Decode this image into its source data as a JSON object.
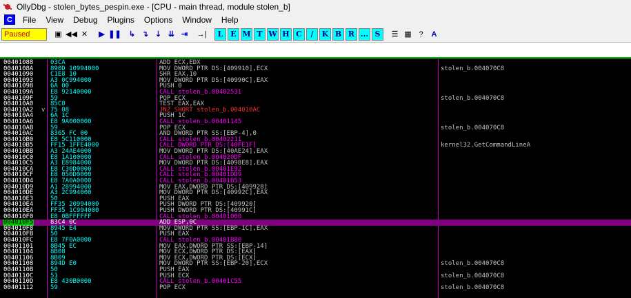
{
  "window": {
    "title": "OllyDbg - stolen_bytes_pespin.exe - [CPU - main thread, module stolen_b]"
  },
  "menu": {
    "c_label": "C",
    "items": [
      "File",
      "View",
      "Debug",
      "Plugins",
      "Options",
      "Window",
      "Help"
    ]
  },
  "toolbar": {
    "status": "Paused",
    "buttons": [
      {
        "name": "open-icon",
        "glyph": "▣"
      },
      {
        "name": "restart-icon",
        "glyph": "◀◀"
      },
      {
        "name": "close-icon",
        "glyph": "✕"
      },
      {
        "name": "run-icon",
        "glyph": "▶"
      },
      {
        "name": "pause-icon",
        "glyph": "❚❚"
      },
      {
        "name": "step-into-icon",
        "glyph": "↳"
      },
      {
        "name": "step-over-icon",
        "glyph": "↴"
      },
      {
        "name": "trace-into-icon",
        "glyph": "⇣"
      },
      {
        "name": "trace-over-icon",
        "glyph": "⇊"
      },
      {
        "name": "execute-till-return-icon",
        "glyph": "⇥"
      },
      {
        "name": "goto-icon",
        "glyph": "→|"
      }
    ],
    "letters": [
      "L",
      "E",
      "M",
      "T",
      "W",
      "H",
      "C",
      "/",
      "K",
      "B",
      "R",
      "...",
      "S"
    ],
    "extra_buttons": [
      {
        "name": "list-icon",
        "glyph": "☰"
      },
      {
        "name": "palette-icon",
        "glyph": "▦"
      },
      {
        "name": "help-icon",
        "glyph": "?"
      },
      {
        "name": "assembler-icon",
        "glyph": "A"
      }
    ]
  },
  "disasm": {
    "selected_index": 27,
    "rows": [
      {
        "addr": "00401088",
        "jmp": "",
        "hex": "03CA",
        "asm": "ADD ECX,EDX",
        "kind": "",
        "comment": ""
      },
      {
        "addr": "0040108A",
        "jmp": "",
        "hex": "890D 10994000",
        "asm": "MOV DWORD PTR DS:[409910],ECX",
        "kind": "",
        "comment": "stolen_b.004070C8"
      },
      {
        "addr": "00401090",
        "jmp": "",
        "hex": "C1E8 10",
        "asm": "SHR EAX,10",
        "kind": "",
        "comment": ""
      },
      {
        "addr": "00401093",
        "jmp": "",
        "hex": "A3 0C994000",
        "asm": "MOV DWORD PTR DS:[40990C],EAX",
        "kind": "",
        "comment": ""
      },
      {
        "addr": "00401098",
        "jmp": "",
        "hex": "6A 00",
        "asm": "PUSH 0",
        "kind": "",
        "comment": ""
      },
      {
        "addr": "0040109A",
        "jmp": "",
        "hex": "E8 92140000",
        "asm": "CALL stolen_b.00402531",
        "kind": "call",
        "comment": ""
      },
      {
        "addr": "0040109F",
        "jmp": "",
        "hex": "59",
        "asm": "POP ECX",
        "kind": "",
        "comment": "stolen_b.004070C8"
      },
      {
        "addr": "004010A0",
        "jmp": "",
        "hex": "85C0",
        "asm": "TEST EAX,EAX",
        "kind": "",
        "comment": ""
      },
      {
        "addr": "004010A2",
        "jmp": "v",
        "hex": "75 08",
        "asm": "JNZ SHORT stolen_b.004010AC",
        "kind": "jmp",
        "comment": ""
      },
      {
        "addr": "004010A4",
        "jmp": "",
        "hex": "6A 1C",
        "asm": "PUSH 1C",
        "kind": "",
        "comment": ""
      },
      {
        "addr": "004010A6",
        "jmp": "",
        "hex": "E8 9A000000",
        "asm": "CALL stolen_b.00401145",
        "kind": "call",
        "comment": ""
      },
      {
        "addr": "004010AB",
        "jmp": "",
        "hex": "59",
        "asm": "POP ECX",
        "kind": "",
        "comment": "stolen_b.004070C8"
      },
      {
        "addr": "004010AC",
        "jmp": "",
        "hex": "8365 FC 00",
        "asm": "AND DWORD PTR SS:[EBP-4],0",
        "kind": "",
        "comment": ""
      },
      {
        "addr": "004010B0",
        "jmp": "",
        "hex": "E8 5C110000",
        "asm": "CALL stolen_b.00402211",
        "kind": "call",
        "comment": ""
      },
      {
        "addr": "004010B5",
        "jmp": "",
        "hex": "FF15 1FFE4000",
        "asm": "CALL DWORD PTR DS:[40FE1F]",
        "kind": "call",
        "comment": "kernel32.GetCommandLineA"
      },
      {
        "addr": "004010BB",
        "jmp": "",
        "hex": "A3 24AE4000",
        "asm": "MOV DWORD PTR DS:[40AE24],EAX",
        "kind": "",
        "comment": ""
      },
      {
        "addr": "004010C0",
        "jmp": "",
        "hex": "E8 1A100000",
        "asm": "CALL stolen_b.004020DF",
        "kind": "call",
        "comment": ""
      },
      {
        "addr": "004010C5",
        "jmp": "",
        "hex": "A3 E8984000",
        "asm": "MOV DWORD PTR DS:[4098E8],EAX",
        "kind": "",
        "comment": ""
      },
      {
        "addr": "004010CA",
        "jmp": "",
        "hex": "E8 C30D0000",
        "asm": "CALL stolen_b.00401E92",
        "kind": "call",
        "comment": ""
      },
      {
        "addr": "004010CF",
        "jmp": "",
        "hex": "E8 050D0000",
        "asm": "CALL stolen_b.00401DD9",
        "kind": "call",
        "comment": ""
      },
      {
        "addr": "004010D4",
        "jmp": "",
        "hex": "E8 7A0A0000",
        "asm": "CALL stolen_b.00401B53",
        "kind": "call",
        "comment": ""
      },
      {
        "addr": "004010D9",
        "jmp": "",
        "hex": "A1 28994000",
        "asm": "MOV EAX,DWORD PTR DS:[409928]",
        "kind": "",
        "comment": ""
      },
      {
        "addr": "004010DE",
        "jmp": "",
        "hex": "A3 2C994000",
        "asm": "MOV DWORD PTR DS:[40992C],EAX",
        "kind": "",
        "comment": ""
      },
      {
        "addr": "004010E3",
        "jmp": "",
        "hex": "50",
        "asm": "PUSH EAX",
        "kind": "",
        "comment": ""
      },
      {
        "addr": "004010E4",
        "jmp": "",
        "hex": "FF35 20994000",
        "asm": "PUSH DWORD PTR DS:[409920]",
        "kind": "",
        "comment": ""
      },
      {
        "addr": "004010EA",
        "jmp": "",
        "hex": "FF35 1C994000",
        "asm": "PUSH DWORD PTR DS:[40991C]",
        "kind": "",
        "comment": ""
      },
      {
        "addr": "004010F0",
        "jmp": "",
        "hex": "E8 0BFFFFFF",
        "asm": "CALL stolen_b.00401000",
        "kind": "call",
        "comment": ""
      },
      {
        "addr": "004010F5",
        "jmp": "",
        "hex": "83C4 0C",
        "asm": "ADD ESP,0C",
        "kind": "",
        "comment": ""
      },
      {
        "addr": "004010F8",
        "jmp": "",
        "hex": "8945 E4",
        "asm": "MOV DWORD PTR SS:[EBP-1C],EAX",
        "kind": "",
        "comment": ""
      },
      {
        "addr": "004010FB",
        "jmp": "",
        "hex": "50",
        "asm": "PUSH EAX",
        "kind": "",
        "comment": ""
      },
      {
        "addr": "004010FC",
        "jmp": "",
        "hex": "E8 7F0A0000",
        "asm": "CALL stolen_b.00401B80",
        "kind": "call",
        "comment": ""
      },
      {
        "addr": "00401101",
        "jmp": "",
        "hex": "8B45 EC",
        "asm": "MOV EAX,DWORD PTR SS:[EBP-14]",
        "kind": "",
        "comment": ""
      },
      {
        "addr": "00401104",
        "jmp": "",
        "hex": "8B08",
        "asm": "MOV ECX,DWORD PTR DS:[EAX]",
        "kind": "",
        "comment": ""
      },
      {
        "addr": "00401106",
        "jmp": "",
        "hex": "8B09",
        "asm": "MOV ECX,DWORD PTR DS:[ECX]",
        "kind": "",
        "comment": ""
      },
      {
        "addr": "00401108",
        "jmp": "",
        "hex": "894D E0",
        "asm": "MOV DWORD PTR SS:[EBP-20],ECX",
        "kind": "",
        "comment": "stolen_b.004070C8"
      },
      {
        "addr": "0040110B",
        "jmp": "",
        "hex": "50",
        "asm": "PUSH EAX",
        "kind": "",
        "comment": ""
      },
      {
        "addr": "0040110C",
        "jmp": "",
        "hex": "51",
        "asm": "PUSH ECX",
        "kind": "",
        "comment": "stolen_b.004070C8"
      },
      {
        "addr": "0040110D",
        "jmp": "",
        "hex": "E8 430B0000",
        "asm": "CALL stolen_b.00401C55",
        "kind": "call",
        "comment": ""
      },
      {
        "addr": "00401112",
        "jmp": "",
        "hex": "59",
        "asm": "POP ECX",
        "kind": "",
        "comment": "stolen_b.004070C8"
      }
    ]
  }
}
